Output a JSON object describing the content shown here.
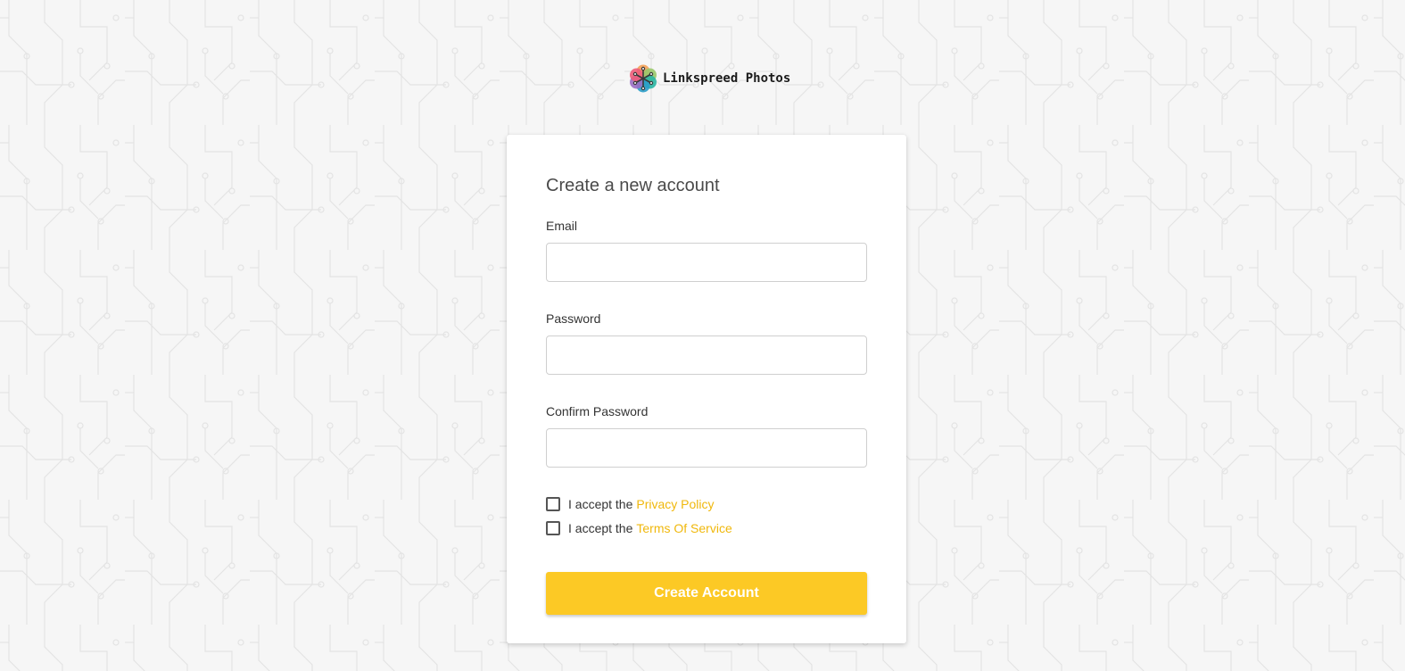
{
  "brand": {
    "name": "Linkspreed Photos",
    "icon": "flower-logo-icon"
  },
  "form": {
    "title": "Create a new account",
    "email_label": "Email",
    "email_value": "",
    "password_label": "Password",
    "password_value": "",
    "confirm_password_label": "Confirm Password",
    "confirm_password_value": "",
    "privacy_prefix": "I accept the",
    "privacy_link": "Privacy Policy",
    "privacy_checked": false,
    "terms_prefix": "I accept the",
    "terms_link": "Terms Of Service",
    "terms_checked": false,
    "submit_label": "Create Account"
  },
  "colors": {
    "accent": "#fcc925",
    "link": "#f0b80c",
    "background": "#f6f6f6",
    "card": "#ffffff"
  }
}
